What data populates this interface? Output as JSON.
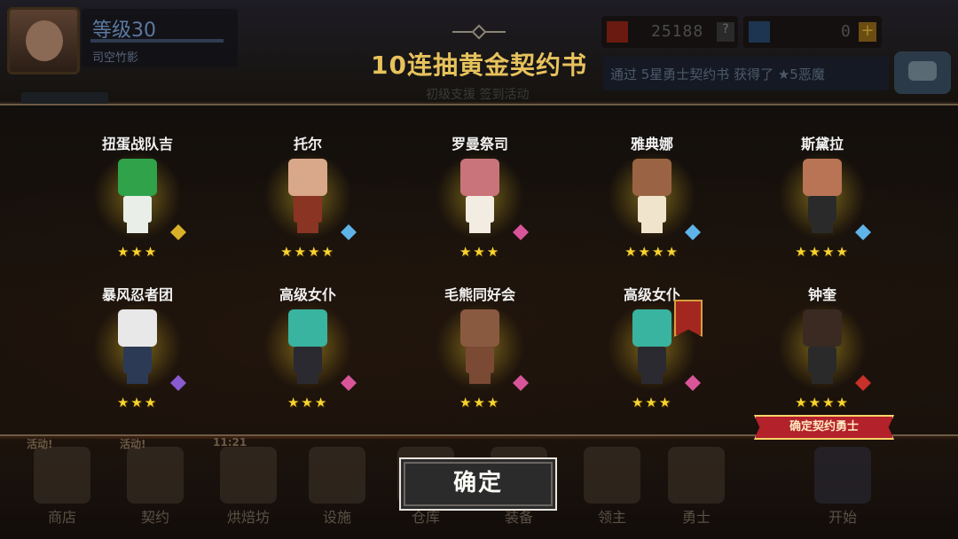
{
  "header": {
    "level": "等级30",
    "player_name": "司空竹影",
    "gold": "25188",
    "gold_help": "?",
    "gems": "0",
    "gems_add": "+",
    "ticker": "通过 5星勇士契约书 获得了 ★5恶魔"
  },
  "activity_labels": [
    "初级支援",
    "签到活动"
  ],
  "modal": {
    "title": "10连抽黄金契约书",
    "heroes": [
      {
        "name": "扭蛋战队吉",
        "stars": "★★★",
        "head": "#2fa24a",
        "body": "#e9eee9",
        "weapon": "#d9b128"
      },
      {
        "name": "托尔",
        "stars": "★★★★",
        "head": "#d9a88a",
        "body": "#8a3424",
        "weapon": "#5fb3e8"
      },
      {
        "name": "罗曼祭司",
        "stars": "★★★",
        "head": "#c9747a",
        "body": "#f2ece2",
        "weapon": "#d9559a"
      },
      {
        "name": "雅典娜",
        "stars": "★★★★",
        "head": "#9a6444",
        "body": "#f0e4cc",
        "weapon": "#5fb3e8"
      },
      {
        "name": "斯黛拉",
        "stars": "★★★★",
        "head": "#b87455",
        "body": "#2a2a2a",
        "weapon": "#5fb3e8"
      },
      {
        "name": "暴风忍者团",
        "stars": "★★★",
        "head": "#e8e8e8",
        "body": "#2c3a56",
        "weapon": "#8a5ad0"
      },
      {
        "name": "高级女仆",
        "stars": "★★★",
        "head": "#39b4a0",
        "body": "#2a2a30",
        "weapon": "#d9559a"
      },
      {
        "name": "毛熊同好会",
        "stars": "★★★",
        "head": "#8a5a40",
        "body": "#7a4a34",
        "weapon": "#d9559a"
      },
      {
        "name": "高级女仆",
        "stars": "★★★",
        "head": "#39b4a0",
        "body": "#2a2a30",
        "weapon": "#d9559a"
      },
      {
        "name": "钟奎",
        "stars": "★★★★",
        "head": "#3a2a22",
        "body": "#2a2a2a",
        "weapon": "#c8302a"
      }
    ],
    "confirm_hero_label": "确定契约勇士",
    "confirm_button": "确定"
  },
  "bottom_nav": [
    {
      "label": "商店",
      "badge": "活动!"
    },
    {
      "label": "契约",
      "badge": "活动!"
    },
    {
      "label": "烘焙坊",
      "badge": "11:21"
    },
    {
      "label": "设施",
      "badge": ""
    },
    {
      "label": "仓库",
      "badge": ""
    },
    {
      "label": "装备",
      "badge": ""
    },
    {
      "label": "领主",
      "badge": ""
    },
    {
      "label": "勇士",
      "badge": ""
    }
  ],
  "start_label": "开始"
}
